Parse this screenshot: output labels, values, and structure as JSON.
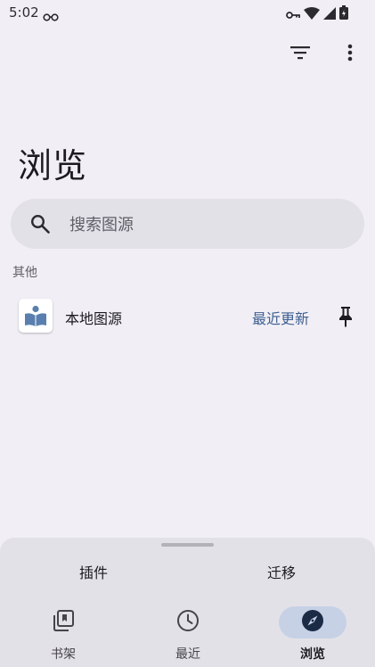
{
  "status_bar": {
    "time": "5:02"
  },
  "header": {
    "title": "浏览"
  },
  "search": {
    "placeholder": "搜索图源"
  },
  "sections": [
    {
      "label": "其他",
      "items": [
        {
          "name": "本地图源",
          "action_label": "最近更新",
          "icon": "local-source-book-icon"
        }
      ]
    }
  ],
  "bottom_sheet": {
    "tabs": [
      {
        "label": "插件"
      },
      {
        "label": "迁移"
      }
    ]
  },
  "nav": {
    "items": [
      {
        "label": "书架",
        "icon": "library-icon",
        "active": false
      },
      {
        "label": "最近",
        "icon": "clock-icon",
        "active": false
      },
      {
        "label": "浏览",
        "icon": "compass-icon",
        "active": true
      }
    ]
  },
  "colors": {
    "background": "#f1eff5",
    "accent": "#3d5f91",
    "active_indicator": "#c6d1e6",
    "surface": "#e3e1e8"
  }
}
